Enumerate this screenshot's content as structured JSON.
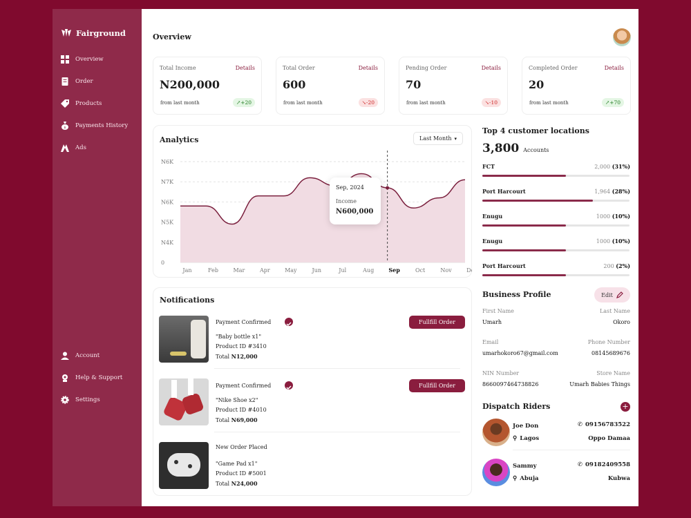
{
  "brand": "Fairground",
  "sidebar": {
    "items": [
      {
        "label": "Overview",
        "icon": "grid-icon"
      },
      {
        "label": "Order",
        "icon": "receipt-icon"
      },
      {
        "label": "Products",
        "icon": "tag-icon"
      },
      {
        "label": "Payments History",
        "icon": "money-bag-icon"
      },
      {
        "label": "Ads",
        "icon": "ads-icon"
      }
    ],
    "bottom": [
      {
        "label": "Account",
        "icon": "user-icon"
      },
      {
        "label": "Help & Support",
        "icon": "support-icon"
      },
      {
        "label": "Settings",
        "icon": "gear-icon"
      }
    ]
  },
  "page_title": "Overview",
  "stats": [
    {
      "label": "Total Income",
      "details": "Details",
      "value": "N200,000",
      "sub": "from last month",
      "change": "+20",
      "trend": "up"
    },
    {
      "label": "Total Order",
      "details": "Details",
      "value": "600",
      "sub": "from last month",
      "change": "-20",
      "trend": "down"
    },
    {
      "label": "Pending Order",
      "details": "Details",
      "value": "70",
      "sub": "from last month",
      "change": "-10",
      "trend": "down"
    },
    {
      "label": "Completed Order",
      "details": "Details",
      "value": "20",
      "sub": "from last month",
      "change": "+70",
      "trend": "up"
    }
  ],
  "analytics": {
    "title": "Analytics",
    "filter": "Last Month",
    "tooltip": {
      "date": "Sep, 2024",
      "label": "Income",
      "value": "N600,000"
    }
  },
  "chart_data": {
    "type": "area",
    "categories": [
      "Jan",
      "Feb",
      "Mar",
      "Apr",
      "May",
      "Jun",
      "Jul",
      "Aug",
      "Sep",
      "Oct",
      "Nov",
      "Dec"
    ],
    "y_ticks": [
      "0",
      "N4K",
      "N5K",
      "N6K",
      "N7K",
      "N6K"
    ],
    "values": [
      2.8,
      2.8,
      1.9,
      3.3,
      3.3,
      4.2,
      3.8,
      4.4,
      3.7,
      2.7,
      3.2,
      4.1
    ],
    "ylim": [
      0,
      5
    ],
    "highlight": "Sep",
    "grid": true,
    "color": "#7a1f3d"
  },
  "notifications": {
    "title": "Notifications",
    "items": [
      {
        "title": "Payment Confirmed",
        "item": "\"Baby bottle x1\"",
        "product_id": "Product ID #3410",
        "total_label": "Total",
        "total": "N12,000",
        "action": "Fullfill Order",
        "confirmed": true
      },
      {
        "title": "Payment Confirmed",
        "item": "\"Nike Shoe x2\"",
        "product_id": "Product ID #4010",
        "total_label": "Total",
        "total": "N69,000",
        "action": "Fullfill Order",
        "confirmed": true
      },
      {
        "title": "New Order Placed",
        "item": "\"Game Pad x1\"",
        "product_id": "Product ID #5001",
        "total_label": "Total",
        "total": "N24,000",
        "action": "",
        "confirmed": false
      }
    ]
  },
  "locations": {
    "title": "Top 4 customer locations",
    "total": "3,800",
    "total_label": "Accounts",
    "items": [
      {
        "name": "FCT",
        "count": "2,000",
        "pct": "(31%)",
        "fill": 0.57
      },
      {
        "name": "Port Harcourt",
        "count": "1,964",
        "pct": "(28%)",
        "fill": 0.75
      },
      {
        "name": "Enugu",
        "count": "1000",
        "pct": "(10%)",
        "fill": 0.57
      },
      {
        "name": "Enugu",
        "count": "1000",
        "pct": "(10%)",
        "fill": 0.57
      },
      {
        "name": "Port Harcourt",
        "count": "200",
        "pct": "(2%)",
        "fill": 0.57
      }
    ]
  },
  "business_profile": {
    "title": "Business Profile",
    "edit": "Edit",
    "first_name_label": "First Name",
    "first_name": "Umarh",
    "last_name_label": "Last Name",
    "last_name": "Okoro",
    "email_label": "Email",
    "email": "umarhokoro67@gmail.com",
    "phone_label": "Phone Number",
    "phone": "08145689676",
    "nin_label": "NIN Number",
    "nin": "8660097464738826",
    "store_label": "Store Name",
    "store": "Umarh Babies Things"
  },
  "riders": {
    "title": "Dispatch Riders",
    "items": [
      {
        "name": "Joe Don",
        "city": "Lagos",
        "phone": "09156783522",
        "area": "Oppo Damaa"
      },
      {
        "name": "Sammy",
        "city": "Abuja",
        "phone": "09182409558",
        "area": "Kubwa"
      }
    ]
  }
}
